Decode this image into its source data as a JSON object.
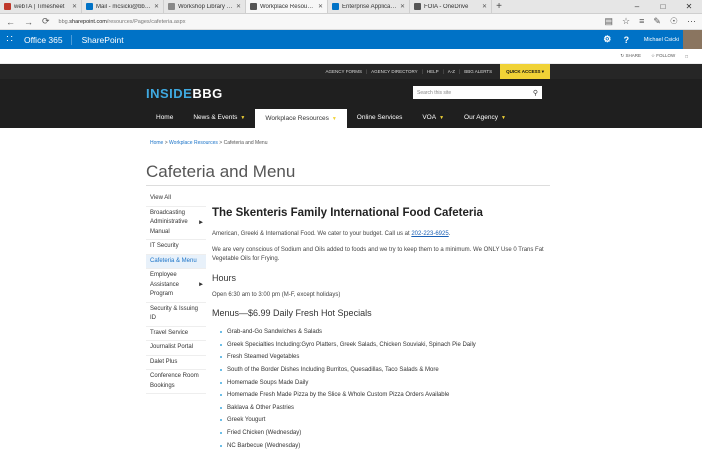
{
  "browser": {
    "tabs": [
      {
        "label": "webTA | Timesheet",
        "color": "#c0392b"
      },
      {
        "label": "Mail - mcsicki@bbg.gov",
        "color": "#0072c6"
      },
      {
        "label": "Workshop Library On-Dema",
        "color": "#888888"
      },
      {
        "label": "Workplace Resources C",
        "color": "#555555",
        "active": true
      },
      {
        "label": "Enterprise Applications Lists",
        "color": "#0072c6"
      },
      {
        "label": "FOIA - OneDrive",
        "color": "#555555"
      }
    ],
    "url_prefix": "bbg.",
    "url_domain": "sharepoint.com",
    "url_path": "/resources/Pages/cafeteria.aspx"
  },
  "o365": {
    "brand": "Office 365",
    "app": "SharePoint",
    "user": "Michael Csicki"
  },
  "share_row": {
    "share": "SHARE",
    "follow": "FOLLOW"
  },
  "utility": {
    "links": [
      "AGENCY FORMS",
      "AGENCY DIRECTORY",
      "HELP",
      "A-Z",
      "BBG ALERTS"
    ],
    "quick_access": "QUICK ACCESS"
  },
  "header": {
    "logo_inside": "INSIDE",
    "logo_bbg": "BBG",
    "search_placeholder": "Search this site"
  },
  "nav": [
    {
      "label": "Home",
      "arrow": false
    },
    {
      "label": "News & Events",
      "arrow": true
    },
    {
      "label": "Workplace Resources",
      "arrow": true,
      "active": true
    },
    {
      "label": "Online Services",
      "arrow": false
    },
    {
      "label": "VOA",
      "arrow": true
    },
    {
      "label": "Our Agency",
      "arrow": true
    }
  ],
  "breadcrumb": {
    "home": "Home",
    "sep1": " > ",
    "parent": "Workplace Resources",
    "sep2": " > ",
    "current": "Cafeteria and Menu"
  },
  "page_title": "Cafeteria and Menu",
  "sidebar": [
    {
      "label": "View All"
    },
    {
      "label": "Broadcasting Administrative Manual",
      "arrow": true
    },
    {
      "label": "IT Security"
    },
    {
      "label": "Cafeteria & Menu",
      "active": true
    },
    {
      "label": "Employee Assistance Program",
      "arrow": true
    },
    {
      "label": "Security & Issuing ID"
    },
    {
      "label": "Travel Service"
    },
    {
      "label": "Journalist Portal"
    },
    {
      "label": "Dalet Plus"
    },
    {
      "label": "Conference Room Bookings"
    }
  ],
  "main": {
    "heading": "The Skenteris Family International Food Cafeteria",
    "intro": "American, Greeki & International Food. We cater to your budget. Call us at ",
    "phone": "202-223-6925",
    "intro_end": ".",
    "notice": "We are very conscious of Sodium and Oils added to foods and we try to keep them to a minimum. We ONLY Use 0 Trans Fat Vegetable Oils for Frying.",
    "hours_heading": "Hours",
    "hours": "Open 6:30 am to 3:00 pm (M-F, except holidays)",
    "menu_heading": "Menus—$6.99 Daily Fresh Hot Specials",
    "specials": [
      "Grab-and-Go Sandwiches & Salads",
      "Greek Specialties Including:Gyro Platters, Greek Salads, Chicken Souviaki, Spinach Pie Daily",
      "Fresh Steamed Vegetables",
      "South of the Border Dishes Including Burritos, Quesadillas, Taco Salads & More",
      "Homemade Soups Made Daily",
      "Homemade Fresh Made Pizza by the Slice & Whole Custom Pizza Orders Available",
      "Baklava & Other Pastries",
      "Greek Yougurt",
      "Fried Chicken (Wednesday)",
      "NC Barbecue (Wednesday)"
    ]
  }
}
